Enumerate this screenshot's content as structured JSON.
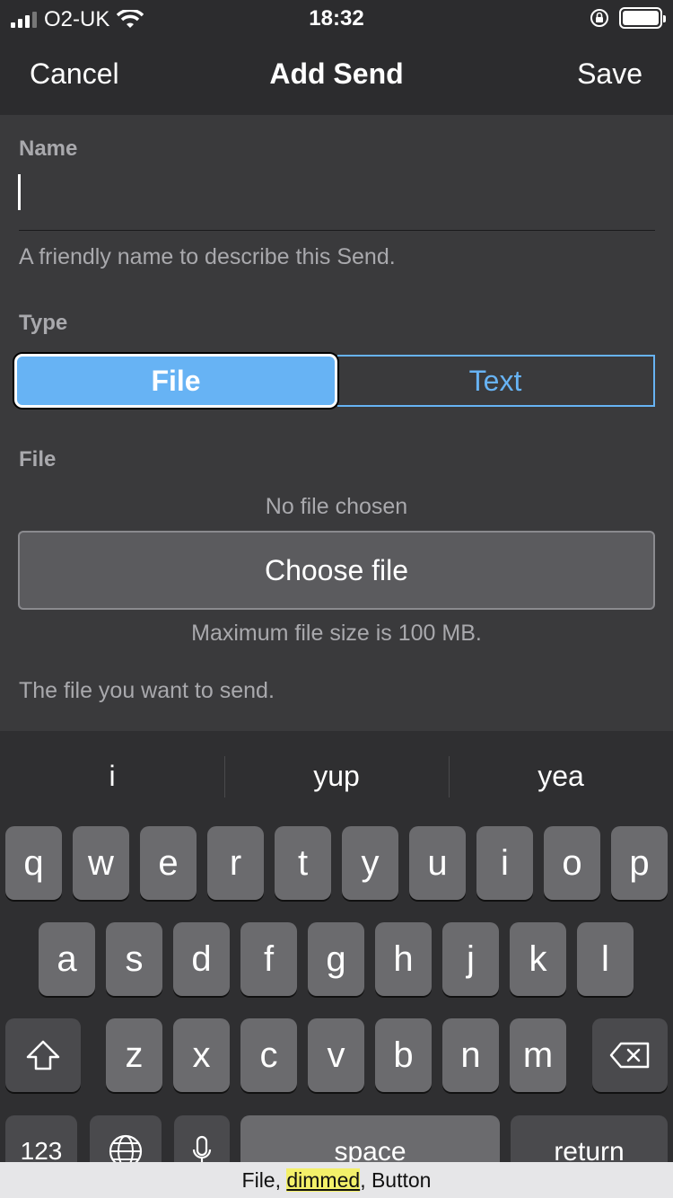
{
  "status_bar": {
    "carrier": "O2-UK",
    "time": "18:32"
  },
  "nav": {
    "cancel": "Cancel",
    "title": "Add Send",
    "save": "Save"
  },
  "form": {
    "name_label": "Name",
    "name_value": "",
    "name_help": "A friendly name to describe this Send.",
    "type_label": "Type",
    "type_options": [
      "File",
      "Text"
    ],
    "selected_type": "File",
    "file_label": "File",
    "no_file": "No file chosen",
    "choose_button": "Choose file",
    "max_size": "Maximum file size is 100 MB.",
    "file_help": "The file you want to send."
  },
  "keyboard": {
    "suggestions": [
      "i",
      "yup",
      "yea"
    ],
    "row1": [
      "q",
      "w",
      "e",
      "r",
      "t",
      "y",
      "u",
      "i",
      "o",
      "p"
    ],
    "row2": [
      "a",
      "s",
      "d",
      "f",
      "g",
      "h",
      "j",
      "k",
      "l"
    ],
    "row3": [
      "z",
      "x",
      "c",
      "v",
      "b",
      "n",
      "m"
    ],
    "bottom": {
      "numbers": "123",
      "space": "space",
      "return": "return"
    }
  },
  "accessibility_caption": {
    "part1": "File, ",
    "part2": "dimmed",
    "part3": ", Button"
  }
}
